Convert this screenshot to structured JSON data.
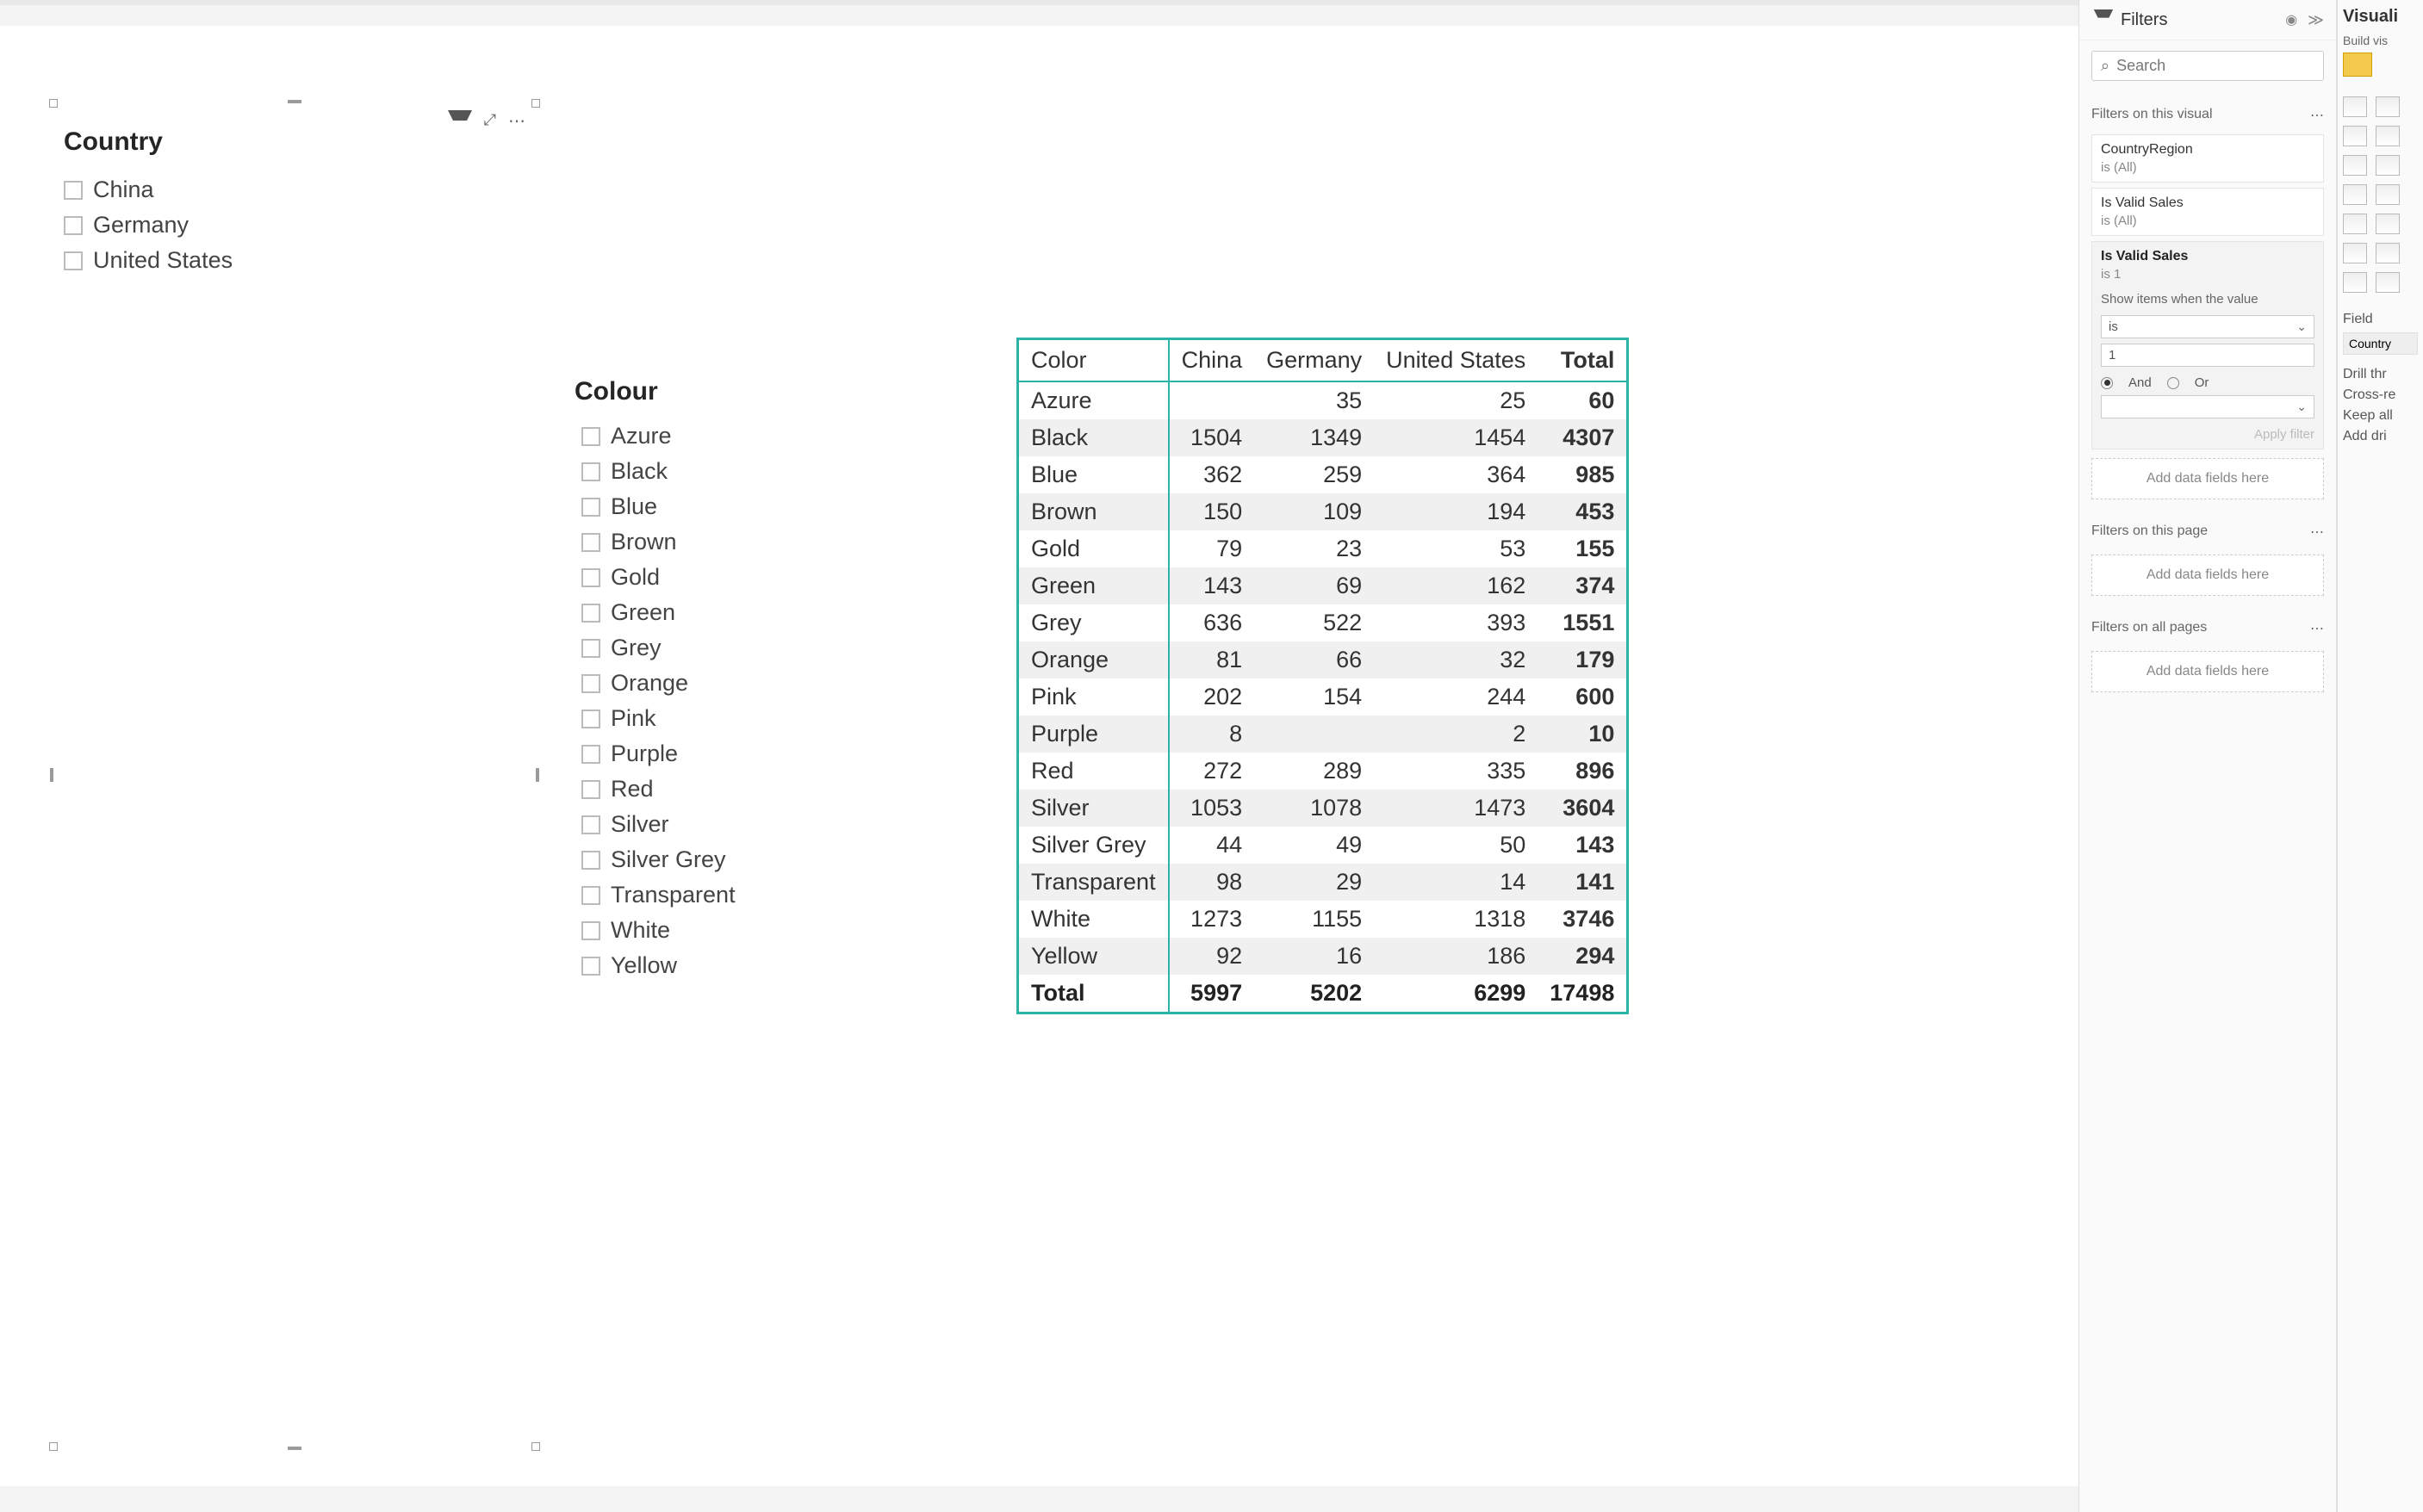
{
  "slicer_country": {
    "title": "Country",
    "items": [
      "China",
      "Germany",
      "United States"
    ]
  },
  "slicer_colour": {
    "title": "Colour",
    "items": [
      "Azure",
      "Black",
      "Blue",
      "Brown",
      "Gold",
      "Green",
      "Grey",
      "Orange",
      "Pink",
      "Purple",
      "Red",
      "Silver",
      "Silver Grey",
      "Transparent",
      "White",
      "Yellow"
    ]
  },
  "matrix": {
    "corner": "Color",
    "columns": [
      "China",
      "Germany",
      "United States"
    ],
    "total_header": "Total",
    "rows": [
      {
        "label": "Azure",
        "vals": [
          "",
          "35",
          "25"
        ],
        "total": "60"
      },
      {
        "label": "Black",
        "vals": [
          "1504",
          "1349",
          "1454"
        ],
        "total": "4307"
      },
      {
        "label": "Blue",
        "vals": [
          "362",
          "259",
          "364"
        ],
        "total": "985"
      },
      {
        "label": "Brown",
        "vals": [
          "150",
          "109",
          "194"
        ],
        "total": "453"
      },
      {
        "label": "Gold",
        "vals": [
          "79",
          "23",
          "53"
        ],
        "total": "155"
      },
      {
        "label": "Green",
        "vals": [
          "143",
          "69",
          "162"
        ],
        "total": "374"
      },
      {
        "label": "Grey",
        "vals": [
          "636",
          "522",
          "393"
        ],
        "total": "1551"
      },
      {
        "label": "Orange",
        "vals": [
          "81",
          "66",
          "32"
        ],
        "total": "179"
      },
      {
        "label": "Pink",
        "vals": [
          "202",
          "154",
          "244"
        ],
        "total": "600"
      },
      {
        "label": "Purple",
        "vals": [
          "8",
          "",
          "2"
        ],
        "total": "10"
      },
      {
        "label": "Red",
        "vals": [
          "272",
          "289",
          "335"
        ],
        "total": "896"
      },
      {
        "label": "Silver",
        "vals": [
          "1053",
          "1078",
          "1473"
        ],
        "total": "3604"
      },
      {
        "label": "Silver Grey",
        "vals": [
          "44",
          "49",
          "50"
        ],
        "total": "143"
      },
      {
        "label": "Transparent",
        "vals": [
          "98",
          "29",
          "14"
        ],
        "total": "141"
      },
      {
        "label": "White",
        "vals": [
          "1273",
          "1155",
          "1318"
        ],
        "total": "3746"
      },
      {
        "label": "Yellow",
        "vals": [
          "92",
          "16",
          "186"
        ],
        "total": "294"
      }
    ],
    "footer": {
      "label": "Total",
      "vals": [
        "5997",
        "5202",
        "6299"
      ],
      "total": "17498"
    }
  },
  "filters_pane": {
    "title": "Filters",
    "search_placeholder": "Search",
    "on_visual": "Filters on this visual",
    "on_page": "Filters on this page",
    "on_all": "Filters on all pages",
    "add_fields": "Add data fields here",
    "cards": [
      {
        "name": "CountryRegion",
        "state": "is (All)"
      },
      {
        "name": "Is Valid Sales",
        "state": "is (All)"
      }
    ],
    "expanded": {
      "name": "Is Valid Sales",
      "state": "is 1",
      "hint": "Show items when the value",
      "op": "is",
      "value": "1",
      "and": "And",
      "or": "Or",
      "apply": "Apply filter"
    }
  },
  "viz_pane": {
    "title": "Visuali",
    "subtitle": "Build vis",
    "fields_label": "Field",
    "field_name": "Country",
    "drill_label": "Drill thr",
    "cross": "Cross-re",
    "keep": "Keep all",
    "add_drill": "Add dri"
  },
  "chart_data": {
    "type": "table",
    "title": "Color by Country matrix",
    "row_field": "Color",
    "column_field": "Country",
    "columns": [
      "China",
      "Germany",
      "United States",
      "Total"
    ],
    "rows": [
      {
        "Color": "Azure",
        "China": null,
        "Germany": 35,
        "United States": 25,
        "Total": 60
      },
      {
        "Color": "Black",
        "China": 1504,
        "Germany": 1349,
        "United States": 1454,
        "Total": 4307
      },
      {
        "Color": "Blue",
        "China": 362,
        "Germany": 259,
        "United States": 364,
        "Total": 985
      },
      {
        "Color": "Brown",
        "China": 150,
        "Germany": 109,
        "United States": 194,
        "Total": 453
      },
      {
        "Color": "Gold",
        "China": 79,
        "Germany": 23,
        "United States": 53,
        "Total": 155
      },
      {
        "Color": "Green",
        "China": 143,
        "Germany": 69,
        "United States": 162,
        "Total": 374
      },
      {
        "Color": "Grey",
        "China": 636,
        "Germany": 522,
        "United States": 393,
        "Total": 1551
      },
      {
        "Color": "Orange",
        "China": 81,
        "Germany": 66,
        "United States": 32,
        "Total": 179
      },
      {
        "Color": "Pink",
        "China": 202,
        "Germany": 154,
        "United States": 244,
        "Total": 600
      },
      {
        "Color": "Purple",
        "China": 8,
        "Germany": null,
        "United States": 2,
        "Total": 10
      },
      {
        "Color": "Red",
        "China": 272,
        "Germany": 289,
        "United States": 335,
        "Total": 896
      },
      {
        "Color": "Silver",
        "China": 1053,
        "Germany": 1078,
        "United States": 1473,
        "Total": 3604
      },
      {
        "Color": "Silver Grey",
        "China": 44,
        "Germany": 49,
        "United States": 50,
        "Total": 143
      },
      {
        "Color": "Transparent",
        "China": 98,
        "Germany": 29,
        "United States": 14,
        "Total": 141
      },
      {
        "Color": "White",
        "China": 1273,
        "Germany": 1155,
        "United States": 1318,
        "Total": 3746
      },
      {
        "Color": "Yellow",
        "China": 92,
        "Germany": 16,
        "United States": 186,
        "Total": 294
      }
    ],
    "totals": {
      "China": 5997,
      "Germany": 5202,
      "United States": 6299,
      "Total": 17498
    }
  }
}
